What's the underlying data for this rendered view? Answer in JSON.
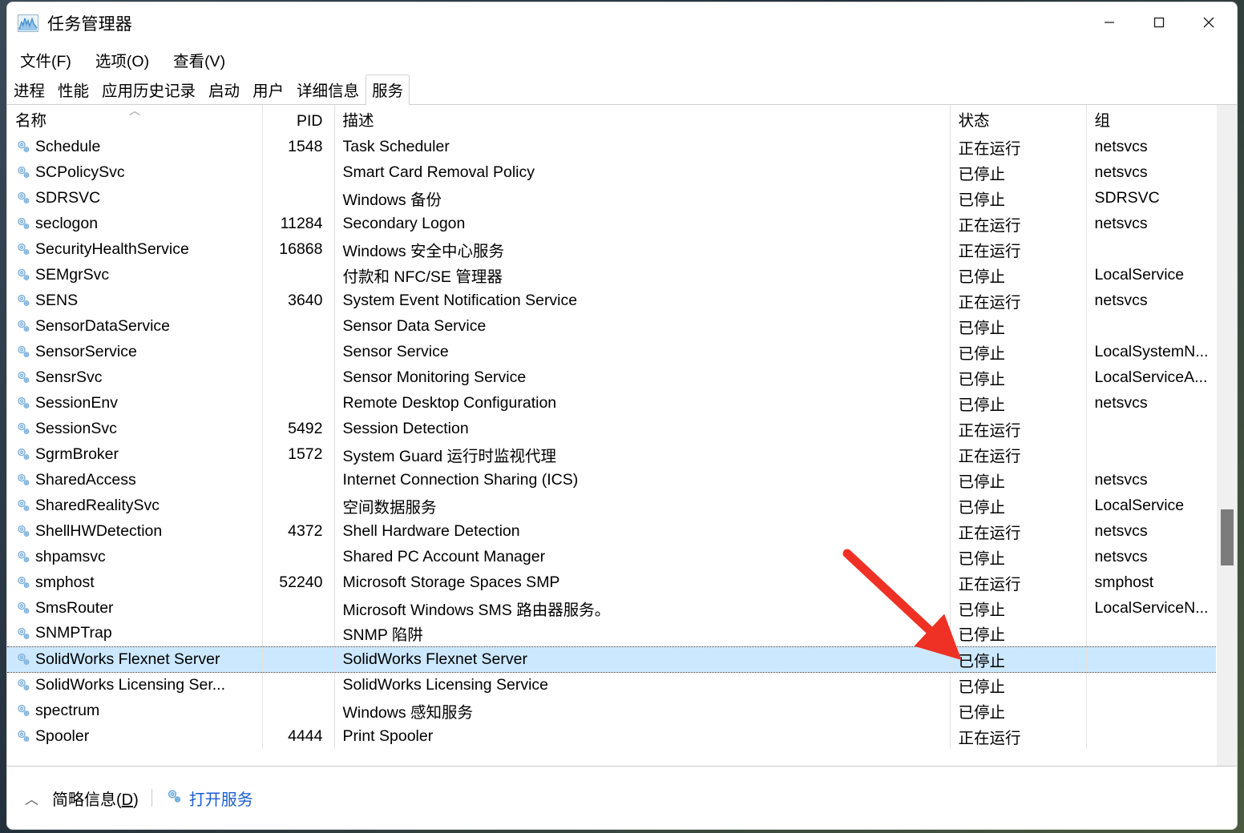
{
  "window": {
    "title": "任务管理器",
    "icon": "chart-icon",
    "controls": {
      "minimize": "minimize-icon",
      "maximize": "maximize-icon",
      "close": "close-icon"
    }
  },
  "menu": {
    "items": [
      "文件(F)",
      "选项(O)",
      "查看(V)"
    ]
  },
  "tabs": {
    "items": [
      "进程",
      "性能",
      "应用历史记录",
      "启动",
      "用户",
      "详细信息",
      "服务"
    ],
    "active": "服务"
  },
  "table": {
    "columns": [
      "名称",
      "PID",
      "描述",
      "状态",
      "组"
    ],
    "sort": {
      "column": "名称",
      "direction": "ascending",
      "glyph": "︿"
    },
    "rows": [
      {
        "name": "Schedule",
        "pid": "1548",
        "desc": "Task Scheduler",
        "status": "正在运行",
        "group": "netsvcs"
      },
      {
        "name": "SCPolicySvc",
        "pid": "",
        "desc": "Smart Card Removal Policy",
        "status": "已停止",
        "group": "netsvcs"
      },
      {
        "name": "SDRSVC",
        "pid": "",
        "desc": "Windows 备份",
        "status": "已停止",
        "group": "SDRSVC"
      },
      {
        "name": "seclogon",
        "pid": "11284",
        "desc": "Secondary Logon",
        "status": "正在运行",
        "group": "netsvcs"
      },
      {
        "name": "SecurityHealthService",
        "pid": "16868",
        "desc": "Windows 安全中心服务",
        "status": "正在运行",
        "group": ""
      },
      {
        "name": "SEMgrSvc",
        "pid": "",
        "desc": "付款和 NFC/SE 管理器",
        "status": "已停止",
        "group": "LocalService"
      },
      {
        "name": "SENS",
        "pid": "3640",
        "desc": "System Event Notification Service",
        "status": "正在运行",
        "group": "netsvcs"
      },
      {
        "name": "SensorDataService",
        "pid": "",
        "desc": "Sensor Data Service",
        "status": "已停止",
        "group": ""
      },
      {
        "name": "SensorService",
        "pid": "",
        "desc": "Sensor Service",
        "status": "已停止",
        "group": "LocalSystemN..."
      },
      {
        "name": "SensrSvc",
        "pid": "",
        "desc": "Sensor Monitoring Service",
        "status": "已停止",
        "group": "LocalServiceA..."
      },
      {
        "name": "SessionEnv",
        "pid": "",
        "desc": "Remote Desktop Configuration",
        "status": "已停止",
        "group": "netsvcs"
      },
      {
        "name": "SessionSvc",
        "pid": "5492",
        "desc": "Session Detection",
        "status": "正在运行",
        "group": ""
      },
      {
        "name": "SgrmBroker",
        "pid": "1572",
        "desc": "System Guard 运行时监视代理",
        "status": "正在运行",
        "group": ""
      },
      {
        "name": "SharedAccess",
        "pid": "",
        "desc": "Internet Connection Sharing (ICS)",
        "status": "已停止",
        "group": "netsvcs"
      },
      {
        "name": "SharedRealitySvc",
        "pid": "",
        "desc": "空间数据服务",
        "status": "已停止",
        "group": "LocalService"
      },
      {
        "name": "ShellHWDetection",
        "pid": "4372",
        "desc": "Shell Hardware Detection",
        "status": "正在运行",
        "group": "netsvcs"
      },
      {
        "name": "shpamsvc",
        "pid": "",
        "desc": "Shared PC Account Manager",
        "status": "已停止",
        "group": "netsvcs"
      },
      {
        "name": "smphost",
        "pid": "52240",
        "desc": "Microsoft Storage Spaces SMP",
        "status": "正在运行",
        "group": "smphost"
      },
      {
        "name": "SmsRouter",
        "pid": "",
        "desc": "Microsoft Windows SMS 路由器服务。",
        "status": "已停止",
        "group": "LocalServiceN..."
      },
      {
        "name": "SNMPTrap",
        "pid": "",
        "desc": "SNMP 陷阱",
        "status": "已停止",
        "group": ""
      },
      {
        "name": "SolidWorks Flexnet Server",
        "pid": "",
        "desc": "SolidWorks Flexnet Server",
        "status": "已停止",
        "group": "",
        "selected": true
      },
      {
        "name": "SolidWorks Licensing Ser...",
        "pid": "",
        "desc": "SolidWorks Licensing Service",
        "status": "已停止",
        "group": ""
      },
      {
        "name": "spectrum",
        "pid": "",
        "desc": "Windows 感知服务",
        "status": "已停止",
        "group": ""
      },
      {
        "name": "Spooler",
        "pid": "4444",
        "desc": "Print Spooler",
        "status": "正在运行",
        "group": ""
      }
    ]
  },
  "footer": {
    "fewer_details": "简略信息(D)",
    "fewer_details_plain": "简略信息(",
    "fewer_accel": "D",
    "fewer_suffix": ")",
    "open_services": "打开服务",
    "chevron": "︿"
  },
  "annotation": {
    "arrow_color": "#ee3124"
  }
}
